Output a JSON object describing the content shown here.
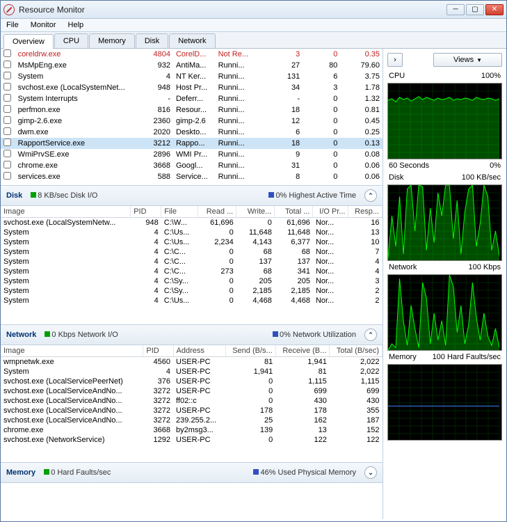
{
  "window": {
    "title": "Resource Monitor"
  },
  "menu": {
    "file": "File",
    "monitor": "Monitor",
    "help": "Help"
  },
  "tabs": [
    "Overview",
    "CPU",
    "Memory",
    "Disk",
    "Network"
  ],
  "overview_cols": [
    "",
    "",
    "",
    "",
    "",
    "",
    "",
    ""
  ],
  "overview_rows": [
    {
      "red": true,
      "image": "coreldrw.exe",
      "pid": "4804",
      "desc": "CorelD...",
      "status": "Not Re...",
      "threads": "3",
      "cpu": "0",
      "avg": "0.35"
    },
    {
      "image": "MsMpEng.exe",
      "pid": "932",
      "desc": "AntiMa...",
      "status": "Runni...",
      "threads": "27",
      "cpu": "80",
      "avg": "79.60"
    },
    {
      "image": "System",
      "pid": "4",
      "desc": "NT Ker...",
      "status": "Runni...",
      "threads": "131",
      "cpu": "6",
      "avg": "3.75"
    },
    {
      "image": "svchost.exe (LocalSystemNet...",
      "pid": "948",
      "desc": "Host Pr...",
      "status": "Runni...",
      "threads": "34",
      "cpu": "3",
      "avg": "1.78"
    },
    {
      "image": "System Interrupts",
      "pid": "-",
      "desc": "Deferr...",
      "status": "Runni...",
      "threads": "-",
      "cpu": "0",
      "avg": "1.32"
    },
    {
      "image": "perfmon.exe",
      "pid": "816",
      "desc": "Resour...",
      "status": "Runni...",
      "threads": "18",
      "cpu": "0",
      "avg": "0.81"
    },
    {
      "image": "gimp-2.6.exe",
      "pid": "2360",
      "desc": "gimp-2.6",
      "status": "Runni...",
      "threads": "12",
      "cpu": "0",
      "avg": "0.45"
    },
    {
      "image": "dwm.exe",
      "pid": "2020",
      "desc": "Deskto...",
      "status": "Runni...",
      "threads": "6",
      "cpu": "0",
      "avg": "0.25"
    },
    {
      "sel": true,
      "image": "RapportService.exe",
      "pid": "3212",
      "desc": "Rappo...",
      "status": "Runni...",
      "threads": "18",
      "cpu": "0",
      "avg": "0.13"
    },
    {
      "image": "WmiPrvSE.exe",
      "pid": "2896",
      "desc": "WMI Pr...",
      "status": "Runni...",
      "threads": "9",
      "cpu": "0",
      "avg": "0.08"
    },
    {
      "image": "chrome.exe",
      "pid": "3668",
      "desc": "Googl...",
      "status": "Runni...",
      "threads": "31",
      "cpu": "0",
      "avg": "0.06"
    },
    {
      "image": "services.exe",
      "pid": "588",
      "desc": "Service...",
      "status": "Runni...",
      "threads": "8",
      "cpu": "0",
      "avg": "0.06"
    }
  ],
  "disk": {
    "title": "Disk",
    "stat1": "8 KB/sec Disk I/O",
    "stat2": "0% Highest Active Time",
    "cols": [
      "Image",
      "PID",
      "File",
      "Read ...",
      "Write...",
      "Total ...",
      "I/O Pr...",
      "Resp..."
    ],
    "rows": [
      {
        "image": "svchost.exe (LocalSystemNetw...",
        "pid": "948",
        "file": "C:\\W...",
        "read": "61,696",
        "write": "0",
        "total": "61,696",
        "pri": "Nor...",
        "resp": "16"
      },
      {
        "image": "System",
        "pid": "4",
        "file": "C:\\Us...",
        "read": "0",
        "write": "11,648",
        "total": "11,648",
        "pri": "Nor...",
        "resp": "13"
      },
      {
        "image": "System",
        "pid": "4",
        "file": "C:\\Us...",
        "read": "2,234",
        "write": "4,143",
        "total": "6,377",
        "pri": "Nor...",
        "resp": "10"
      },
      {
        "image": "System",
        "pid": "4",
        "file": "C:\\C...",
        "read": "0",
        "write": "68",
        "total": "68",
        "pri": "Nor...",
        "resp": "7"
      },
      {
        "image": "System",
        "pid": "4",
        "file": "C:\\C...",
        "read": "0",
        "write": "137",
        "total": "137",
        "pri": "Nor...",
        "resp": "4"
      },
      {
        "image": "System",
        "pid": "4",
        "file": "C:\\C...",
        "read": "273",
        "write": "68",
        "total": "341",
        "pri": "Nor...",
        "resp": "4"
      },
      {
        "image": "System",
        "pid": "4",
        "file": "C:\\Sy...",
        "read": "0",
        "write": "205",
        "total": "205",
        "pri": "Nor...",
        "resp": "3"
      },
      {
        "image": "System",
        "pid": "4",
        "file": "C:\\Sy...",
        "read": "0",
        "write": "2,185",
        "total": "2,185",
        "pri": "Nor...",
        "resp": "2"
      },
      {
        "image": "System",
        "pid": "4",
        "file": "C:\\Us...",
        "read": "0",
        "write": "4,468",
        "total": "4,468",
        "pri": "Nor...",
        "resp": "2"
      }
    ]
  },
  "network": {
    "title": "Network",
    "stat1": "0 Kbps Network I/O",
    "stat2": "0% Network Utilization",
    "cols": [
      "Image",
      "PID",
      "Address",
      "Send (B/s...",
      "Receive (B...",
      "Total (B/sec)"
    ],
    "rows": [
      {
        "image": "wmpnetwk.exe",
        "pid": "4560",
        "addr": "USER-PC",
        "send": "81",
        "recv": "1,941",
        "total": "2,022"
      },
      {
        "image": "System",
        "pid": "4",
        "addr": "USER-PC",
        "send": "1,941",
        "recv": "81",
        "total": "2,022"
      },
      {
        "image": "svchost.exe (LocalServicePeerNet)",
        "pid": "376",
        "addr": "USER-PC",
        "send": "0",
        "recv": "1,115",
        "total": "1,115"
      },
      {
        "image": "svchost.exe (LocalServiceAndNo...",
        "pid": "3272",
        "addr": "USER-PC",
        "send": "0",
        "recv": "699",
        "total": "699"
      },
      {
        "image": "svchost.exe (LocalServiceAndNo...",
        "pid": "3272",
        "addr": "ff02::c",
        "send": "0",
        "recv": "430",
        "total": "430"
      },
      {
        "image": "svchost.exe (LocalServiceAndNo...",
        "pid": "3272",
        "addr": "USER-PC",
        "send": "178",
        "recv": "178",
        "total": "355"
      },
      {
        "image": "svchost.exe (LocalServiceAndNo...",
        "pid": "3272",
        "addr": "239.255.2...",
        "send": "25",
        "recv": "162",
        "total": "187"
      },
      {
        "image": "chrome.exe",
        "pid": "3668",
        "addr": "by2msg3...",
        "send": "139",
        "recv": "13",
        "total": "152"
      },
      {
        "image": "svchost.exe (NetworkService)",
        "pid": "1292",
        "addr": "USER-PC",
        "send": "0",
        "recv": "122",
        "total": "122"
      }
    ]
  },
  "memory": {
    "title": "Memory",
    "stat1": "0 Hard Faults/sec",
    "stat2": "46% Used Physical Memory"
  },
  "right": {
    "views": "Views",
    "graphs": [
      {
        "left": "CPU",
        "right": "100%",
        "bleft": "60 Seconds",
        "bright": "0%"
      },
      {
        "left": "Disk",
        "right": "100 KB/sec"
      },
      {
        "left": "Network",
        "right": "100 Kbps"
      },
      {
        "left": "Memory",
        "right": "100 Hard Faults/sec"
      }
    ]
  },
  "chart_data": [
    {
      "type": "area",
      "title": "CPU",
      "ylim": [
        0,
        100
      ],
      "xrange_seconds": 60,
      "series": [
        {
          "name": "CPU",
          "values": [
            78,
            80,
            76,
            82,
            79,
            81,
            77,
            80,
            83,
            79,
            82,
            80,
            78,
            81,
            79,
            80,
            82,
            78,
            80,
            79,
            81,
            80,
            78,
            82,
            80,
            79,
            81,
            80,
            78,
            80
          ]
        }
      ]
    },
    {
      "type": "area",
      "title": "Disk",
      "ylim": [
        0,
        100
      ],
      "unit": "KB/sec",
      "series": [
        {
          "name": "Disk",
          "values": [
            5,
            60,
            20,
            85,
            10,
            95,
            100,
            40,
            100,
            98,
            15,
            70,
            25,
            90,
            60,
            100,
            100,
            30,
            80,
            10,
            65,
            95,
            100,
            20,
            50,
            100,
            85,
            15,
            40,
            8
          ]
        }
      ]
    },
    {
      "type": "area",
      "title": "Network",
      "ylim": [
        0,
        100
      ],
      "unit": "Kbps",
      "series": [
        {
          "name": "Network",
          "values": [
            2,
            10,
            5,
            95,
            40,
            8,
            60,
            30,
            5,
            90,
            70,
            10,
            50,
            15,
            40,
            8,
            100,
            85,
            25,
            60,
            10,
            35,
            90,
            45,
            15,
            50,
            20,
            8,
            30,
            5
          ]
        }
      ]
    },
    {
      "type": "line",
      "title": "Memory",
      "ylim": [
        0,
        100
      ],
      "unit": "Hard Faults/sec",
      "series": [
        {
          "name": "Memory",
          "values": [
            46,
            46,
            46,
            46,
            46,
            46,
            46,
            46,
            46,
            46,
            46,
            46,
            46,
            46,
            46,
            46,
            46,
            46,
            46,
            46,
            46,
            46,
            46,
            46,
            46,
            46,
            46,
            46,
            46,
            46
          ]
        }
      ]
    }
  ]
}
